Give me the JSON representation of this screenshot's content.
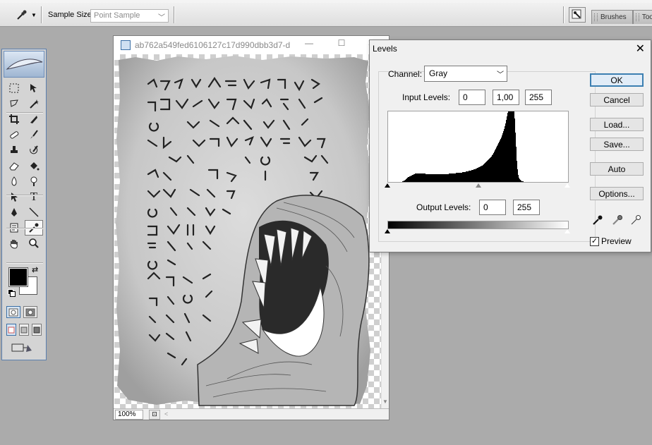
{
  "options_bar": {
    "sample_size_label": "Sample Size:",
    "sample_size_value": "Point Sample",
    "panel_tabs": [
      "Brushes",
      "Too"
    ]
  },
  "toolbox": {
    "tools": [
      "marquee-icon",
      "move-icon",
      "lasso-icon",
      "magic-wand-icon",
      "crop-icon",
      "slice-icon",
      "healing-brush-icon",
      "brush-icon",
      "clone-stamp-icon",
      "history-brush-icon",
      "eraser-icon",
      "paint-bucket-icon",
      "blur-icon",
      "dodge-icon",
      "path-selection-icon",
      "type-icon",
      "pen-icon",
      "line-icon",
      "notes-icon",
      "eyedropper-icon",
      "hand-icon",
      "zoom-icon"
    ],
    "active_tool": "eyedropper-icon",
    "foreground_color": "#000000",
    "background_color": "#ffffff"
  },
  "document": {
    "title": "ab762a549fed6106127c17d990dbb3d7-d...",
    "zoom": "100%"
  },
  "levels": {
    "title": "Levels",
    "channel_label": "Channel:",
    "channel_value": "Gray",
    "input_levels_label": "Input Levels:",
    "input_black": "0",
    "input_gamma": "1,00",
    "input_white": "255",
    "output_levels_label": "Output Levels:",
    "output_black": "0",
    "output_white": "255",
    "buttons": {
      "ok": "OK",
      "cancel": "Cancel",
      "load": "Load...",
      "save": "Save...",
      "auto": "Auto",
      "options": "Options..."
    },
    "preview_label": "Preview",
    "preview_checked": true,
    "histogram": [
      0,
      0,
      0,
      0,
      0,
      0,
      0,
      0,
      0,
      0,
      0,
      0,
      0,
      0,
      0,
      0,
      0,
      0,
      0,
      0,
      1,
      1,
      2,
      2,
      3,
      4,
      5,
      6,
      7,
      7,
      8,
      8,
      9,
      9,
      10,
      10,
      11,
      11,
      12,
      12,
      12,
      12,
      12,
      12,
      12,
      12,
      12,
      12,
      12,
      12,
      12,
      12,
      12,
      11,
      11,
      11,
      11,
      11,
      11,
      11,
      11,
      11,
      11,
      11,
      11,
      11,
      11,
      11,
      11,
      11,
      11,
      11,
      11,
      11,
      11,
      11,
      11,
      11,
      11,
      11,
      11,
      11,
      11,
      11,
      11,
      11,
      12,
      12,
      12,
      12,
      12,
      12,
      12,
      12,
      12,
      12,
      13,
      13,
      13,
      13,
      13,
      13,
      13,
      13,
      13,
      14,
      14,
      14,
      14,
      14,
      15,
      15,
      15,
      15,
      16,
      16,
      16,
      16,
      17,
      17,
      17,
      18,
      18,
      18,
      19,
      19,
      20,
      20,
      21,
      21,
      22,
      22,
      23,
      23,
      24,
      25,
      26,
      27,
      28,
      29,
      30,
      31,
      32,
      33,
      34,
      35,
      36,
      38,
      39,
      41,
      43,
      45,
      47,
      49,
      51,
      53,
      55,
      57,
      59,
      61,
      63,
      66,
      69,
      72,
      75,
      79,
      83,
      88,
      93,
      98,
      100,
      100,
      100,
      100,
      100,
      100,
      100,
      100,
      100,
      90,
      70,
      50,
      30,
      18,
      10,
      6,
      4,
      3,
      2,
      1,
      1,
      1,
      0,
      0,
      0,
      0,
      0,
      0,
      0,
      0,
      0,
      0,
      0,
      0,
      0,
      0,
      0,
      0,
      0,
      0,
      0,
      0,
      0,
      0,
      0,
      0,
      0,
      0,
      0,
      0,
      0,
      0,
      0,
      0,
      0,
      0,
      0,
      0,
      0,
      0,
      0,
      0,
      0,
      0,
      0,
      0,
      0,
      0,
      0,
      0,
      0,
      0,
      0,
      0,
      0,
      0,
      0,
      0,
      0,
      0,
      0,
      0,
      0,
      0,
      0,
      0,
      0,
      0,
      0,
      0,
      0,
      0,
      0,
      0,
      0,
      0,
      0,
      0,
      0,
      0,
      0,
      0
    ]
  }
}
